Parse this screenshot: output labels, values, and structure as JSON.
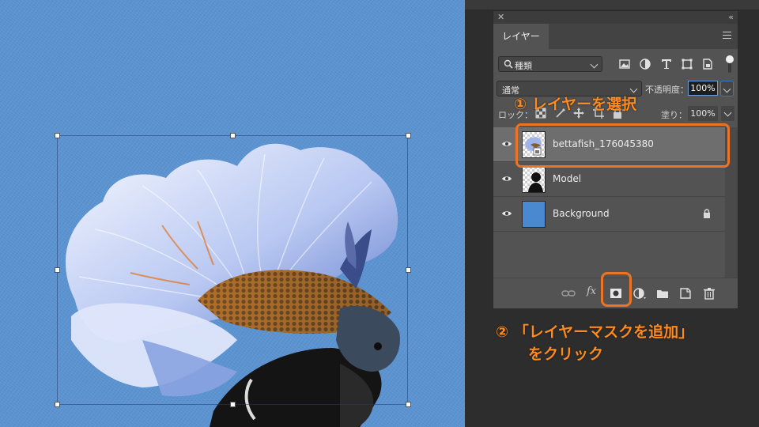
{
  "panel": {
    "tab": "レイヤー",
    "filter": {
      "label": "種類"
    },
    "blend_mode": "通常",
    "opacity_label": "不透明度：",
    "opacity_value": "100%",
    "lock_label": "ロック：",
    "fill_label": "塗り：",
    "fill_value": "100%",
    "layers": [
      {
        "name": "bettafish_176045380",
        "selected": true,
        "visible": true,
        "locked": false
      },
      {
        "name": "Model",
        "selected": false,
        "visible": true,
        "locked": false
      },
      {
        "name": "Background",
        "selected": false,
        "visible": true,
        "locked": true
      }
    ],
    "bottom": {
      "fx": "fx"
    }
  },
  "annotations": {
    "step1": "① レイヤーを選択",
    "step2_line1": "② 「レイヤーマスクを追加」",
    "step2_line2": "をクリック"
  },
  "colors": {
    "canvas_bg": "#5b93d1",
    "accent": "#ec7424",
    "annotation_text": "#ff8a1e",
    "panel_bg": "#535353",
    "selected_row": "#6e6e6e",
    "background_layer_fill": "#4a88d0"
  }
}
